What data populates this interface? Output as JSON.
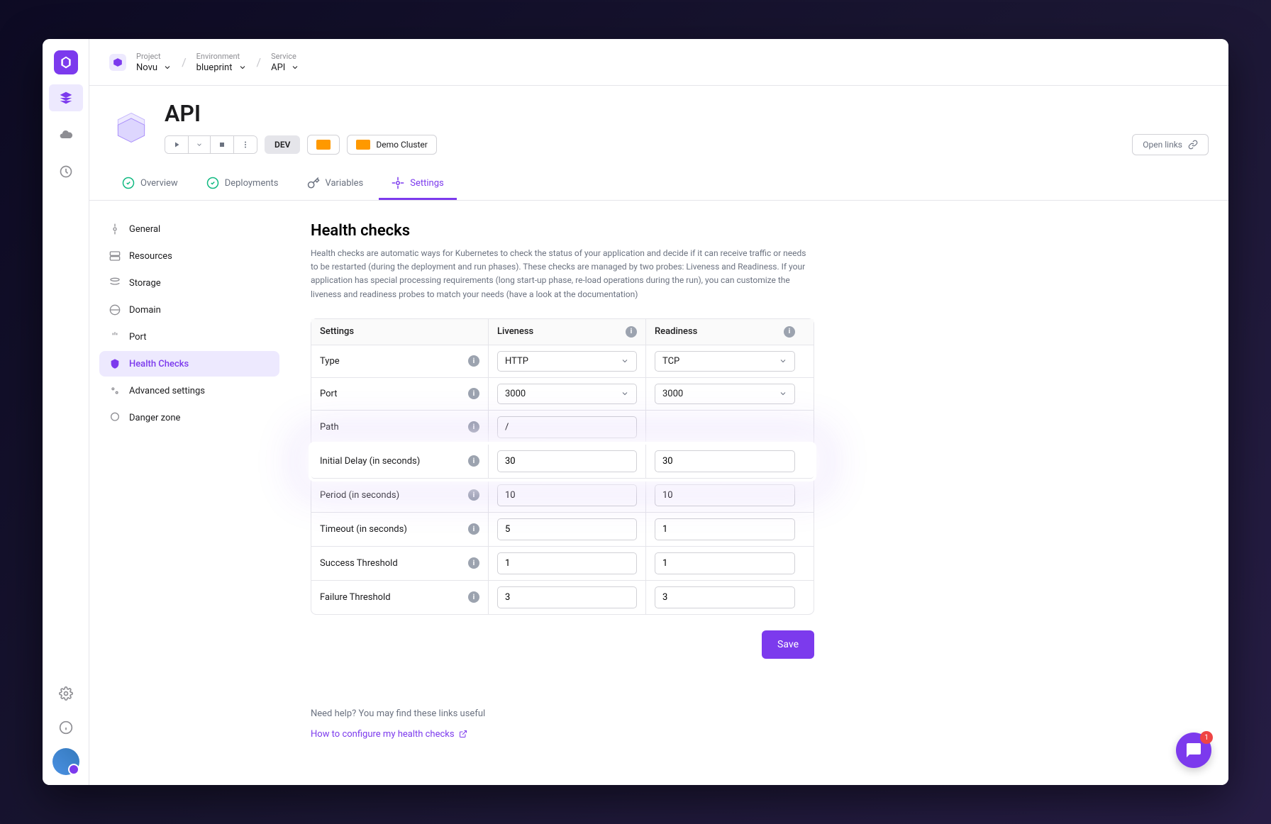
{
  "breadcrumb": {
    "project_label": "Project",
    "project_value": "Novu",
    "env_label": "Environment",
    "env_value": "blueprint",
    "service_label": "Service",
    "service_value": "API"
  },
  "header": {
    "title": "API",
    "dev_badge": "DEV",
    "cluster": "Demo Cluster",
    "open_links": "Open links"
  },
  "tabs": {
    "overview": "Overview",
    "deployments": "Deployments",
    "variables": "Variables",
    "settings": "Settings"
  },
  "settings_nav": {
    "general": "General",
    "resources": "Resources",
    "storage": "Storage",
    "domain": "Domain",
    "port": "Port",
    "health_checks": "Health Checks",
    "advanced": "Advanced settings",
    "danger": "Danger zone"
  },
  "panel": {
    "title": "Health checks",
    "description": "Health checks are automatic ways for Kubernetes to check the status of your application and decide if it can receive traffic or needs to be restarted (during the deployment and run phases). These checks are managed by two probes: Liveness and Readiness. If your application has special processing requirements (long start-up phase, re-load operations during the run), you can customize the liveness and readiness probes to match your needs (have a look at the documentation)"
  },
  "table": {
    "headers": {
      "settings": "Settings",
      "liveness": "Liveness",
      "readiness": "Readiness"
    },
    "rows": {
      "type": {
        "label": "Type",
        "liveness": "HTTP",
        "readiness": "TCP"
      },
      "port": {
        "label": "Port",
        "liveness": "3000",
        "readiness": "3000"
      },
      "path": {
        "label": "Path",
        "liveness": "/"
      },
      "initial_delay": {
        "label": "Initial Delay (in seconds)",
        "liveness": "30",
        "readiness": "30"
      },
      "period": {
        "label": "Period (in seconds)",
        "liveness": "10",
        "readiness": "10"
      },
      "timeout": {
        "label": "Timeout (in seconds)",
        "liveness": "5",
        "readiness": "1"
      },
      "success": {
        "label": "Success Threshold",
        "liveness": "1",
        "readiness": "1"
      },
      "failure": {
        "label": "Failure Threshold",
        "liveness": "3",
        "readiness": "3"
      }
    }
  },
  "save_label": "Save",
  "help": {
    "title": "Need help? You may find these links useful",
    "link": "How to configure my health checks"
  },
  "chat_count": "1"
}
